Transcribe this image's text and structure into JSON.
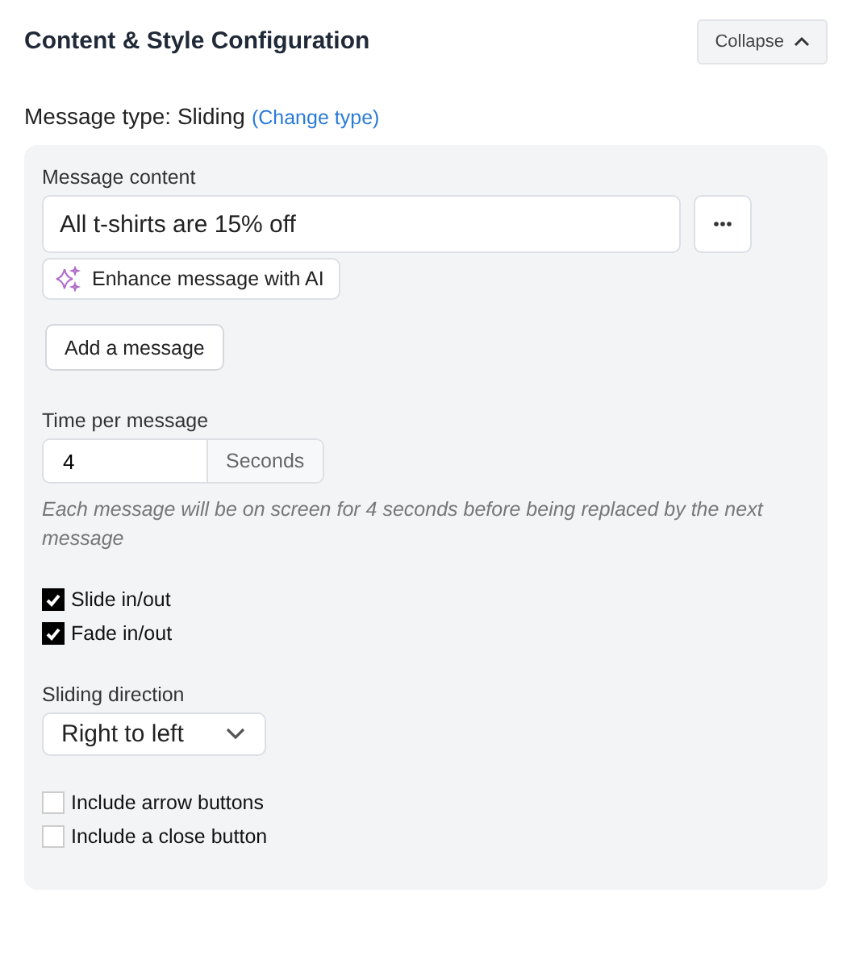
{
  "header": {
    "title": "Content & Style Configuration",
    "collapse_button": "Collapse"
  },
  "message_type": {
    "label": "Message type: Sliding",
    "link": "(Change type)"
  },
  "message_content": {
    "label": "Message content",
    "value": "All t-shirts are 15% off",
    "enhance_button": "Enhance message with AI"
  },
  "add_button": "Add a message",
  "time_per_message": {
    "label": "Time per message",
    "value": "4",
    "unit": "Seconds",
    "hint": "Each message will be on screen for 4 seconds before being replaced by the next message"
  },
  "effects": [
    {
      "label": "Slide in/out",
      "checked": true
    },
    {
      "label": "Fade in/out",
      "checked": true
    }
  ],
  "sliding_direction": {
    "label": "Sliding direction",
    "value": "Right to left"
  },
  "extras": [
    {
      "label": "Include arrow buttons",
      "checked": false
    },
    {
      "label": "Include a close button",
      "checked": false
    }
  ]
}
